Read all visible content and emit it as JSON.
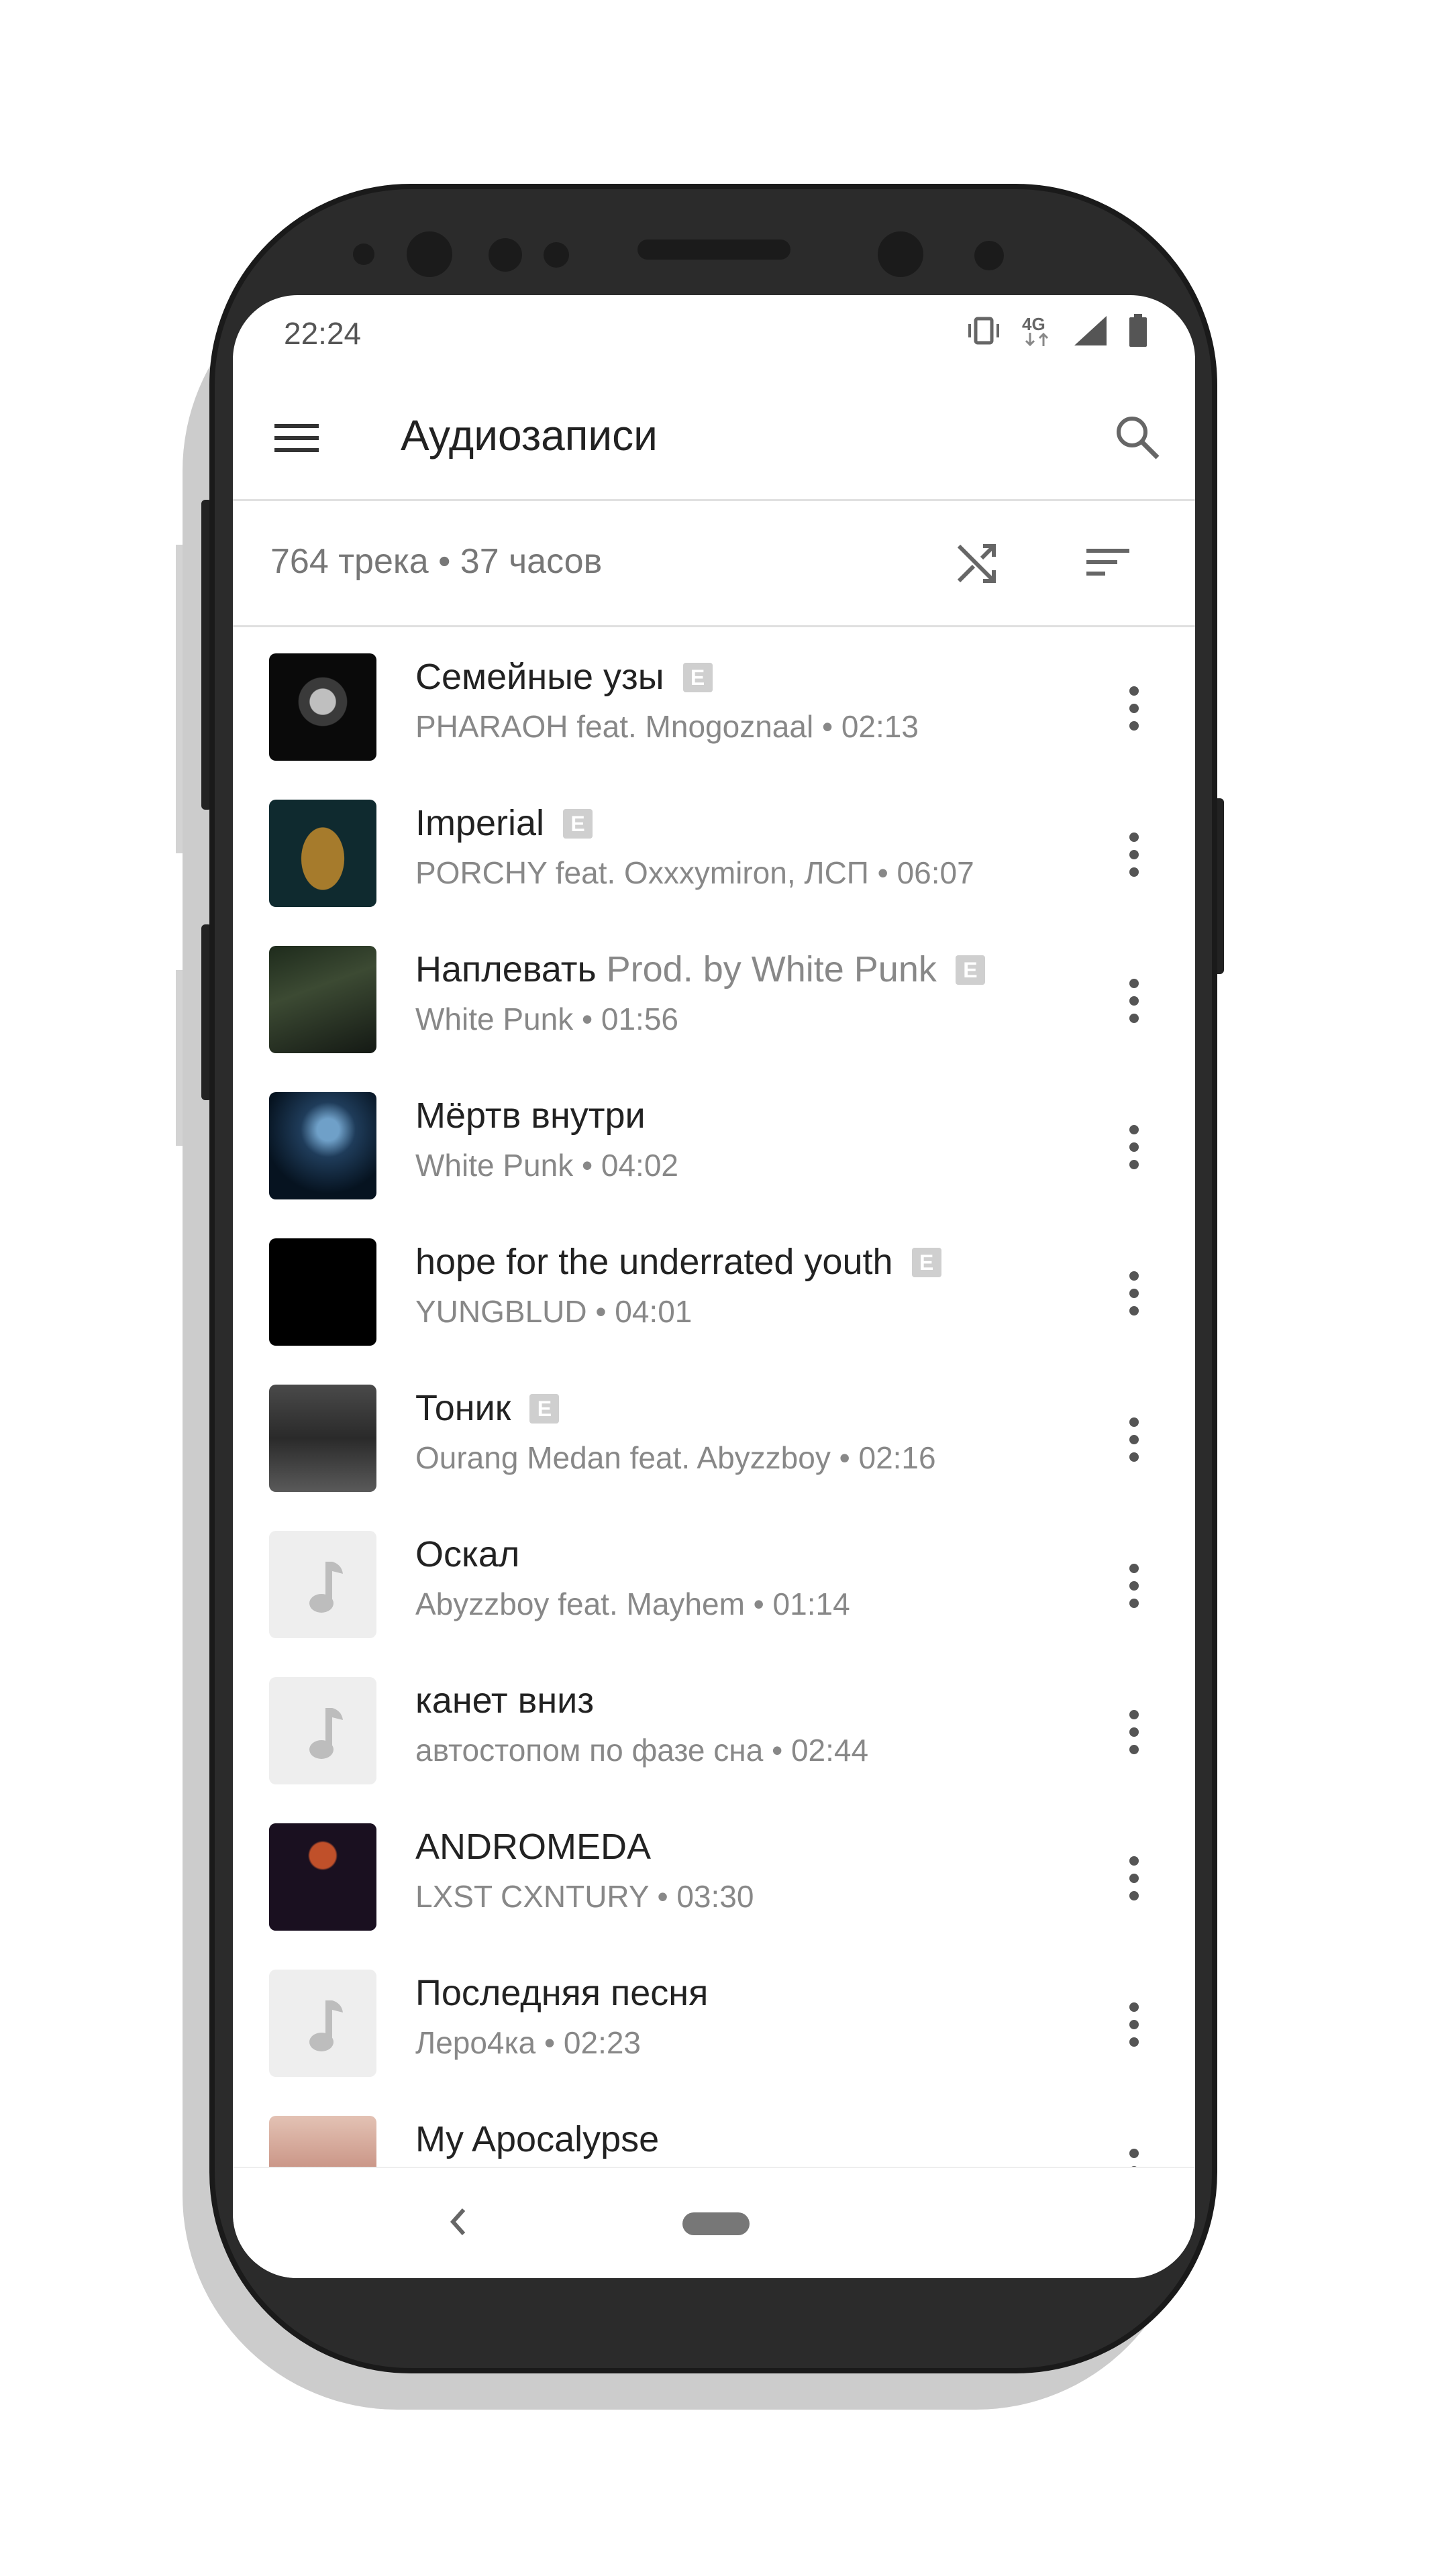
{
  "status": {
    "time": "22:24",
    "network_label": "4G",
    "icons": [
      "vibrate-icon",
      "network-4g-icon",
      "signal-icon",
      "battery-icon"
    ]
  },
  "toolbar": {
    "title": "Аудиозаписи",
    "icons": [
      "menu-icon",
      "search-icon"
    ]
  },
  "summary": {
    "text": "764 трека • 37 часов",
    "icons": [
      "shuffle-icon",
      "sort-icon"
    ]
  },
  "colors": {
    "accent_text": "#222222",
    "secondary_text": "#888888",
    "divider": "#e0e0e0",
    "explicit_badge": "#cfcfcf"
  },
  "tracks": [
    {
      "title": "Семейные узы",
      "extra": "",
      "explicit": "E",
      "subtitle": "PHARAOH feat. Mnogoznaal • 02:13",
      "cover": "dark-portrait"
    },
    {
      "title": "Imperial",
      "extra": "",
      "explicit": "E",
      "subtitle": "PORCHY feat. Oxxxymiron, ЛСП • 06:07",
      "cover": "teal-egg"
    },
    {
      "title": "Наплевать",
      "extra": "Prod. by White Punk",
      "explicit": "E",
      "subtitle": "White Punk • 01:56",
      "cover": "dark-forest"
    },
    {
      "title": "Мёртв внутри",
      "extra": "",
      "explicit": "",
      "subtitle": "White Punk • 04:02",
      "cover": "blue-smoke"
    },
    {
      "title": "hope for the underrated youth",
      "extra": "",
      "explicit": "E",
      "subtitle": "YUNGBLUD • 04:01",
      "cover": "black"
    },
    {
      "title": "Тоник",
      "extra": "",
      "explicit": "E",
      "subtitle": "Ourang Medan feat. Abyzzboy • 02:16",
      "cover": "gray-gothic"
    },
    {
      "title": "Оскал",
      "extra": "",
      "explicit": "",
      "subtitle": "Abyzzboy feat. Mayhem • 01:14",
      "cover": "placeholder"
    },
    {
      "title": "канет вниз",
      "extra": "",
      "explicit": "",
      "subtitle": "автостопом по фазе сна • 02:44",
      "cover": "placeholder"
    },
    {
      "title": "ANDROMEDA",
      "extra": "",
      "explicit": "",
      "subtitle": "LXST CXNTURY • 03:30",
      "cover": "purple-figure"
    },
    {
      "title": "Последняя песня",
      "extra": "",
      "explicit": "",
      "subtitle": "Леро4ка • 02:23",
      "cover": "placeholder"
    },
    {
      "title": "My Apocalypse",
      "extra": "",
      "explicit": "",
      "subtitle": "",
      "cover": "face"
    }
  ]
}
